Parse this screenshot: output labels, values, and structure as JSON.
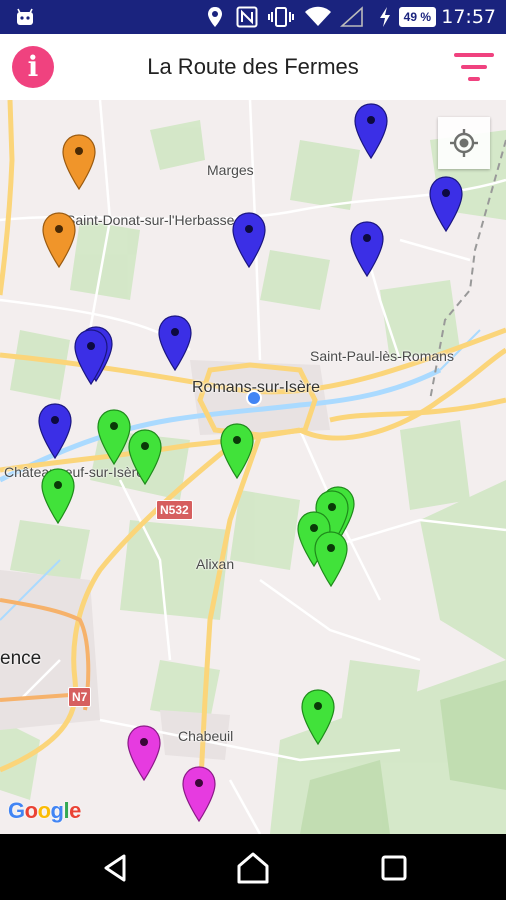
{
  "status_bar": {
    "time": "17:57",
    "battery": "49 %",
    "icons": [
      "android-icon",
      "location-icon",
      "nfc-icon",
      "vibrate-icon",
      "wifi-icon",
      "signal-icon",
      "charging-icon"
    ]
  },
  "app_bar": {
    "title": "La Route des Fermes",
    "info_icon": "info-icon",
    "info_glyph": "i",
    "filter_icon": "filter-icon",
    "accent": "#f0427f"
  },
  "map": {
    "places": [
      {
        "id": "marges",
        "label": "Marges"
      },
      {
        "id": "saint-donat",
        "label": "Saint-Donat-sur-l'Herbasse"
      },
      {
        "id": "saint-paul",
        "label": "Saint-Paul-lès-Romans"
      },
      {
        "id": "romans",
        "label": "Romans-sur-Isère"
      },
      {
        "id": "chateauneuf",
        "label": "Châteauneuf-sur-Isère"
      },
      {
        "id": "alixan",
        "label": "Alixan"
      },
      {
        "id": "valence",
        "label": "ence"
      },
      {
        "id": "chabeuil",
        "label": "Chabeuil"
      }
    ],
    "road_shields": [
      {
        "id": "n532",
        "label": "N532"
      },
      {
        "id": "n7",
        "label": "N7"
      }
    ],
    "attribution": "Google",
    "marker_colors": {
      "blue": "#3b2fe6",
      "green": "#41e23a",
      "orange": "#f0952a",
      "magenta": "#e63be0"
    },
    "marker_counts": {
      "blue": 9,
      "green": 10,
      "orange": 2,
      "magenta": 2
    }
  },
  "nav_bar": {
    "back_icon": "back-icon",
    "home_icon": "home-icon",
    "recents_icon": "recents-icon"
  }
}
